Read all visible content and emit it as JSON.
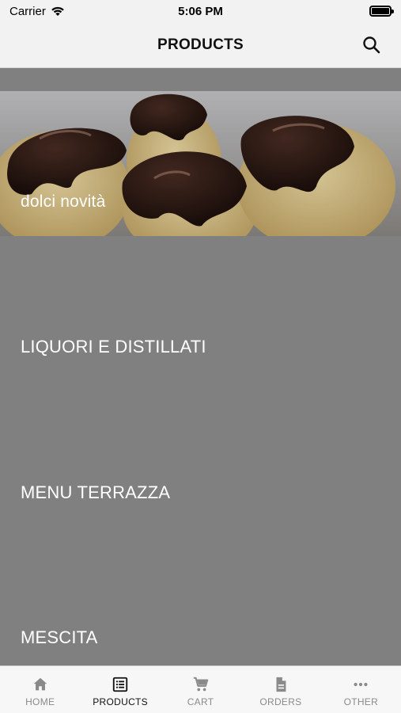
{
  "status_bar": {
    "carrier": "Carrier",
    "time": "5:06 PM"
  },
  "nav": {
    "title": "PRODUCTS",
    "search_icon": "search-icon"
  },
  "categories": [
    {
      "label": "dolci novità",
      "image": "chocolate-profiteroles"
    },
    {
      "label": "LIQUORI E DISTILLATI"
    },
    {
      "label": "MENU TERRAZZA"
    },
    {
      "label": "MESCITA"
    }
  ],
  "tabs": [
    {
      "label": "HOME",
      "icon": "home-icon",
      "active": false
    },
    {
      "label": "PRODUCTS",
      "icon": "list-icon",
      "active": true
    },
    {
      "label": "CART",
      "icon": "cart-icon",
      "active": false
    },
    {
      "label": "ORDERS",
      "icon": "document-icon",
      "active": false
    },
    {
      "label": "OTHER",
      "icon": "more-icon",
      "active": false
    }
  ],
  "colors": {
    "list_background": "#808080",
    "bar_background": "#f2f2f2",
    "tab_active": "#111111",
    "tab_inactive": "#8a8a8a"
  }
}
